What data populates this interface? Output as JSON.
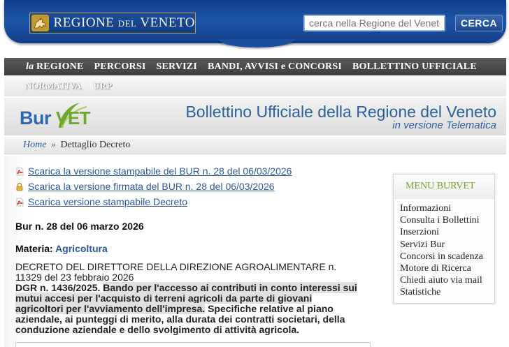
{
  "header": {
    "logo_main": "REGIONE ",
    "logo_del": "DEL",
    "logo_end": " VENETO",
    "search_placeholder": "cerca nella Regione del Veneto",
    "search_button": "CERCA"
  },
  "main_nav": {
    "items": [
      {
        "prefix": "la",
        "label": " REGIONE"
      },
      {
        "prefix": "",
        "label": "PERCORSI"
      },
      {
        "prefix": "",
        "label": "SERVIZI"
      },
      {
        "prefix": "",
        "label": "BANDI, AVVISI e CONCORSI"
      },
      {
        "prefix": "",
        "label": "BOLLETTINO UFFICIALE"
      }
    ]
  },
  "sub_nav": {
    "items": [
      "NORMATIVA",
      "URP"
    ]
  },
  "banner": {
    "logo_bur": "Bur",
    "logo_vet": "VET",
    "title": "Bollettino Ufficiale della Regione del Veneto",
    "subtitle": "in versione Telematica"
  },
  "breadcrumb": {
    "home": "Home",
    "separator": "»",
    "current": "Dettaglio Decreto"
  },
  "downloads": [
    {
      "icon": "pdf-icon",
      "label": "Scarica la versione stampabile del BUR n. 28 del 06/03/2026"
    },
    {
      "icon": "lock-icon",
      "label": "Scarica la versione firmata del BUR n. 28 del 06/03/2026"
    },
    {
      "icon": "pdf-icon",
      "label": "Scarica versione stampabile Decreto"
    }
  ],
  "bur_heading": "Bur n. 28 del 06 marzo 2026",
  "materia": {
    "label": "Materia: ",
    "value": "Agricoltura"
  },
  "decree": {
    "title": "DECRETO DEL DIRETTORE DELLA DIREZIONE AGROALIMENTARE n. 11329 del 23 febbraio 2026",
    "number": "DGR n. 1436/2025. ",
    "body_highlighted": "Bando per l'accesso ai contributi in conto interessi sui mutui accesi per l'acquisto di terreni agricoli da parte di giovani agricoltori per l'avviamento dell'impresa.",
    "body_rest": " Specifiche relative al piano aziendale, ai punteggi di merito, alla durata dei contratti societari, della conduzione aziendale e dello svolgimento di attività agricola."
  },
  "menu": {
    "title": "MENU BURVET",
    "items": [
      "Informazioni",
      "Consulta i Bollettini",
      "Inserzioni",
      "Servizi Bur",
      "Concorsi in scadenza",
      "Motore di Ricerca",
      "Chiedi aiuto via mail",
      "Statistiche"
    ]
  },
  "colors": {
    "header_blue": "#1d55a8",
    "link_blue": "#2b5a9c",
    "menu_green": "#79a02b",
    "nav_dark": "#4a4a4a"
  }
}
